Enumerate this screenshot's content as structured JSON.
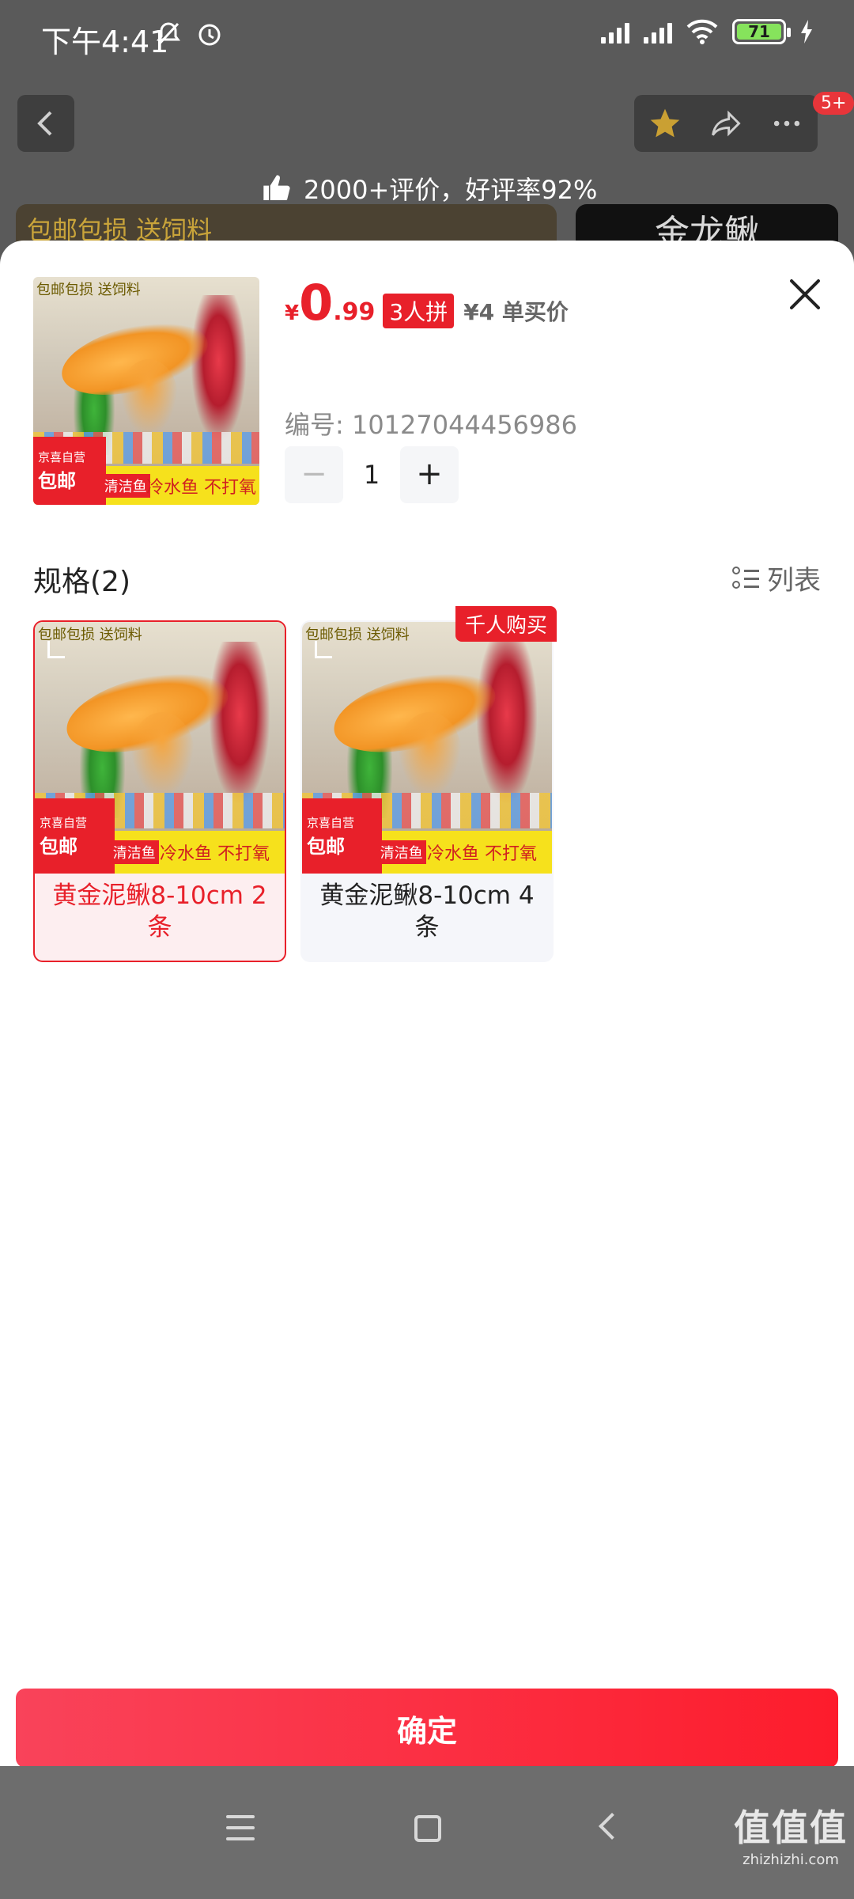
{
  "status_bar": {
    "time": "下午4:41",
    "battery": "71"
  },
  "background": {
    "rating_text": "2000+评价，好评率92%",
    "banner_left_text": "包邮包损 送饲料",
    "banner_right_text": "金龙鳅",
    "cart_badge": "5+"
  },
  "product": {
    "image_tag_top": "包邮包损 送饲料",
    "image_jd_small": "京喜自营",
    "image_jd_big": "包邮",
    "image_strip_1": "清洁鱼",
    "image_strip_2": "冷水鱼 不打氧",
    "price_symbol": "¥",
    "price_int": "0",
    "price_dec": ".99",
    "group_tag": "3人拼",
    "single_price": "¥4 单买价",
    "code": "编号: 10127044456986",
    "quantity": "1",
    "minus": "−",
    "plus": "+"
  },
  "specs": {
    "title": "规格(2)",
    "list_toggle": "列表",
    "items": [
      {
        "label": "黄金泥鳅8-10cm 2条",
        "selected": true
      },
      {
        "label": "黄金泥鳅8-10cm 4条",
        "selected": false,
        "tag": "千人购买"
      }
    ]
  },
  "confirm_label": "确定",
  "watermark": {
    "line1": "值值值",
    "line2": "zhizhizhi.com"
  },
  "colors": {
    "accent": "#e8202a",
    "confirm_start": "#f9435a",
    "confirm_end": "#fd1c2c"
  }
}
